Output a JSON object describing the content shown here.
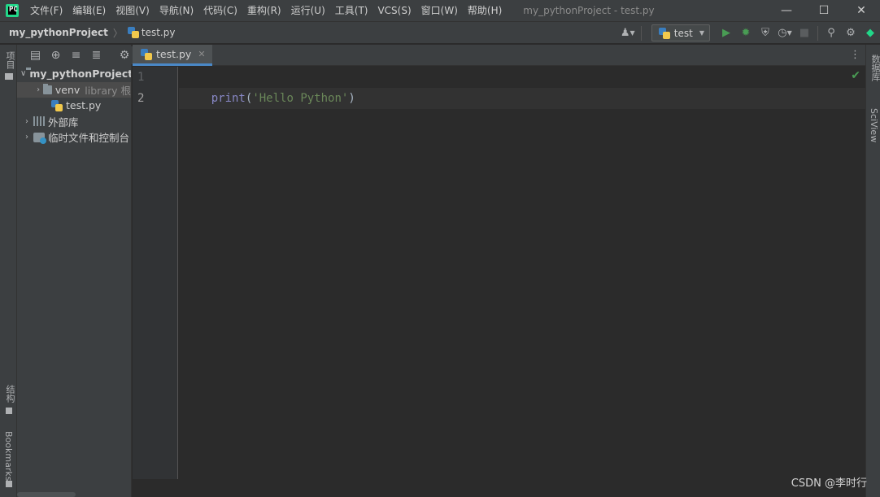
{
  "app": {
    "logo_text": "PC",
    "window_title": "my_pythonProject - test.py"
  },
  "menu": [
    "文件(F)",
    "编辑(E)",
    "视图(V)",
    "导航(N)",
    "代码(C)",
    "重构(R)",
    "运行(U)",
    "工具(T)",
    "VCS(S)",
    "窗口(W)",
    "帮助(H)"
  ],
  "window_controls": {
    "minimize": "—",
    "maximize": "☐",
    "close": "✕"
  },
  "breadcrumb": {
    "project": "my_pythonProject",
    "file": "test.py"
  },
  "toolbar": {
    "run_config": "test"
  },
  "left_strip": {
    "project_label": "项目",
    "structure_label": "结构",
    "bookmarks_label": "Bookmarks"
  },
  "right_strip": {
    "database_label": "数据库",
    "sciview_label": "SciView"
  },
  "project_tree": {
    "root": "my_pythonProject",
    "venv": "venv",
    "venv_note": "library 根",
    "file": "test.py",
    "external_libs": "外部库",
    "scratches": "临时文件和控制台"
  },
  "editor": {
    "tab": "test.py",
    "line_numbers": [
      "1",
      "2"
    ],
    "code": {
      "func": "print",
      "open": "(",
      "string": "'Hello Python'",
      "close": ")"
    }
  },
  "watermark": "CSDN @李时行",
  "colors": {
    "accent": "#4a88c7",
    "run_green": "#499c54",
    "string": "#6a8759",
    "builtin": "#8888c6"
  }
}
